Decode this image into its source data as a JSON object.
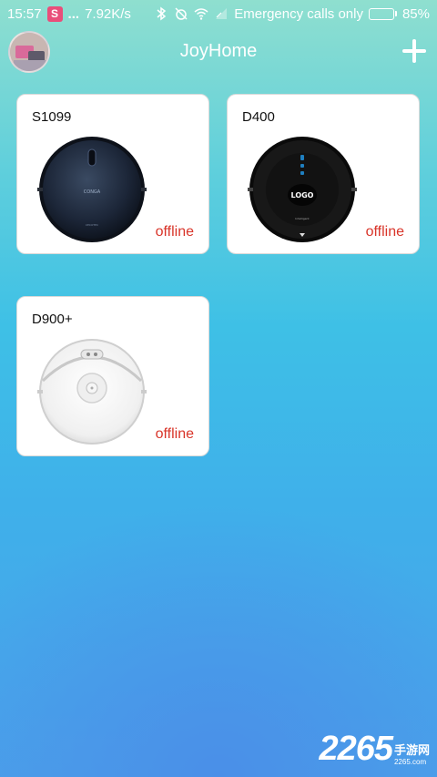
{
  "status_bar": {
    "time": "15:57",
    "app_badge": "S",
    "dots": "...",
    "speed": "7.92K/s",
    "network": "Emergency calls only",
    "battery_percent": "85%",
    "battery_level": 0.85
  },
  "header": {
    "title": "JoyHome",
    "avatar_icon": "user-avatar",
    "add_icon": "plus-icon"
  },
  "devices": [
    {
      "name": "S1099",
      "status": "offline",
      "icon": "robot-vacuum-dark-blue"
    },
    {
      "name": "D400",
      "status": "offline",
      "icon": "robot-vacuum-black-logo",
      "logo_text": "LOGO"
    },
    {
      "name": "D900+",
      "status": "offline",
      "icon": "robot-vacuum-white"
    }
  ],
  "watermark": {
    "number": "2265",
    "chinese": "手游网",
    "url": "2265.com"
  },
  "colors": {
    "status_offline": "#d9352a",
    "gradient_top": "#8fdfcf",
    "gradient_bottom": "#4aa2ea"
  }
}
